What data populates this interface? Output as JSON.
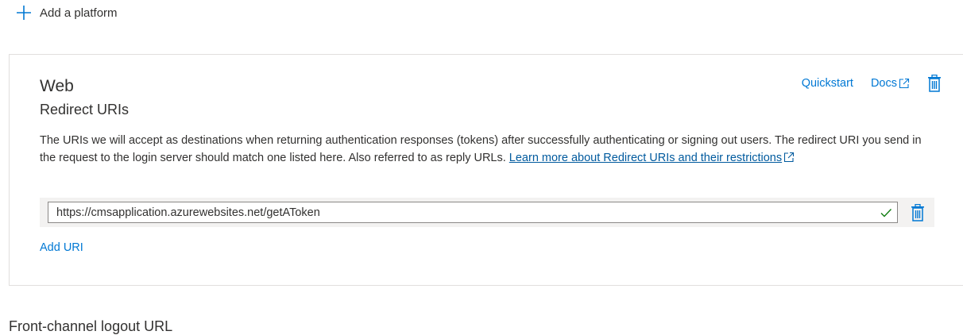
{
  "add_platform": {
    "label": "Add a platform",
    "icon": "plus-icon"
  },
  "web_card": {
    "title": "Web",
    "subtitle": "Redirect URIs",
    "description": "The URIs we will accept as destinations when returning authentication responses (tokens) after successfully authenticating or signing out users. The redirect URI you send in the request to the login server should match one listed here. Also referred to as reply URLs. ",
    "learn_more_link": "Learn more about Redirect URIs and their restrictions",
    "actions": {
      "quickstart": "Quickstart",
      "docs": "Docs",
      "delete_icon": "trash-icon"
    },
    "redirect_uris": [
      {
        "value": "https://cmsapplication.azurewebsites.net/getAToken",
        "status": "valid",
        "status_icon": "check-icon",
        "status_color": "#107c10",
        "delete_icon": "trash-icon"
      }
    ],
    "add_uri_label": "Add URI"
  },
  "next_section": {
    "heading": "Front-channel logout URL"
  },
  "colors": {
    "accent": "#0078d4",
    "link": "#005a9e",
    "border": "#e1dfdd",
    "row_background": "#f3f2f1",
    "text": "#323130"
  }
}
